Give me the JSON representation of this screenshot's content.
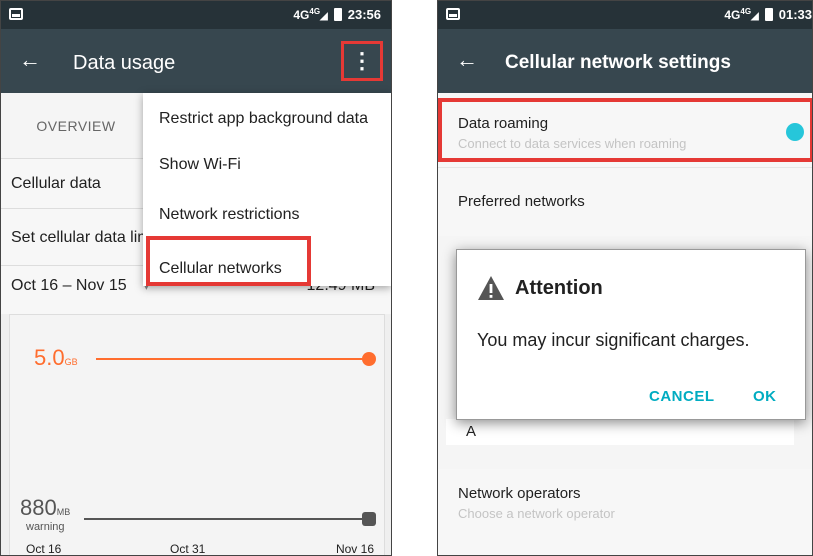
{
  "left": {
    "status": {
      "network": "4G",
      "network_sup": "4G",
      "time": "23:56"
    },
    "appbar": {
      "back": "←",
      "title": "Data usage",
      "overflow": "⋮"
    },
    "tab_overview": "OVERVIEW",
    "rows": {
      "cellular_data": "Cellular data",
      "set_cellular": "Set cellular data limit",
      "cycle": "Oct 16 – Nov 15",
      "cycle_arrow": "▾",
      "usage": "12.49 MB"
    },
    "chart": {
      "limit_value": "5.0",
      "limit_unit": "GB",
      "warning_value": "880",
      "warning_unit": "MB",
      "warning_label": "warning",
      "x_labels": [
        "Oct 16",
        "Oct 31",
        "Nov 16"
      ]
    },
    "menu": {
      "items": [
        "Restrict app background data",
        "Show Wi-Fi",
        "Network restrictions",
        "Cellular networks"
      ]
    }
  },
  "right": {
    "status": {
      "network": "4G",
      "network_sup": "4G",
      "time": "01:33"
    },
    "appbar": {
      "back": "←",
      "title": "Cellular network settings"
    },
    "data_roaming": {
      "title": "Data roaming",
      "subtitle": "Connect to data services when roaming",
      "enabled": true
    },
    "preferred_networks": "Preferred networks",
    "hidden_row_initial": "A",
    "network_operators": {
      "title": "Network operators",
      "subtitle": "Choose a network operator"
    },
    "dialog": {
      "title": "Attention",
      "message": "You may incur significant charges.",
      "cancel": "CANCEL",
      "ok": "OK"
    }
  },
  "colors": {
    "status_bar": "#263238",
    "app_bar": "#37474f",
    "highlight": "#e53935",
    "limit": "#ff6d2e",
    "warning": "#555555",
    "accent": "#00acc1",
    "toggle": "#26c6da"
  }
}
